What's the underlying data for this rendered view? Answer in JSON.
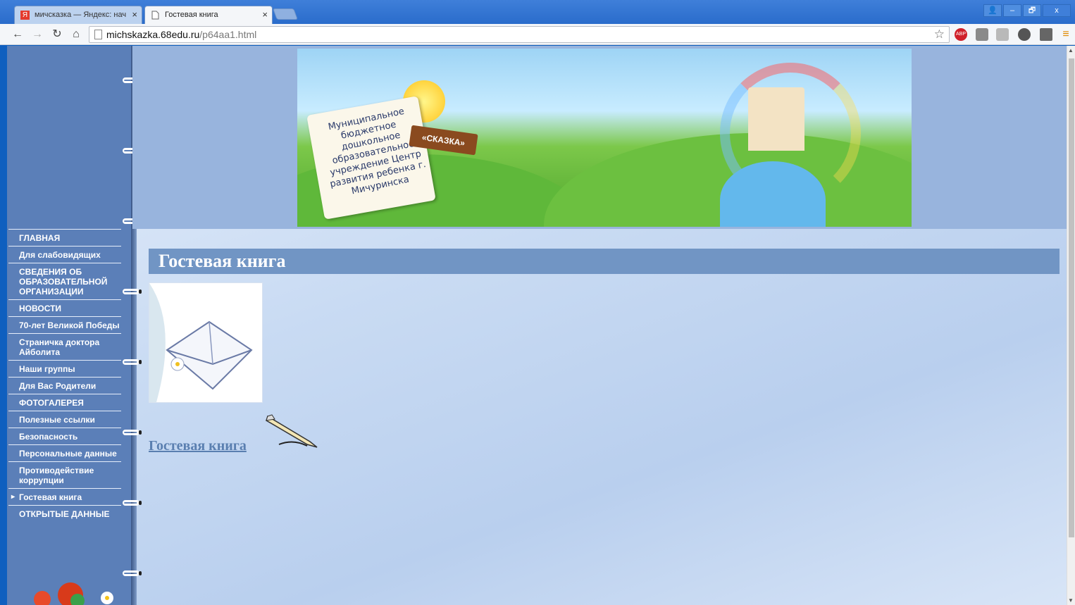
{
  "browser": {
    "tabs": [
      {
        "favicon": "Я",
        "title": "мичсказка — Яндекс: нач",
        "close": "×"
      },
      {
        "favicon": "page-icon",
        "title": "Гостевая книга",
        "close": "×"
      }
    ],
    "url_host": "michskazka.68edu.ru",
    "url_path": "/p64aa1.html",
    "abp_badge": "ABP",
    "window_controls": [
      "👤",
      "–",
      "🗗",
      "x"
    ]
  },
  "banner": {
    "sign_text": "Муниципальное бюджетное дошкольное образовательное учреждение Центр развития ребенка г. Мичуринска",
    "sign_name": "«СКАЗКА»"
  },
  "sidebar": {
    "items": [
      {
        "label": "ГЛАВНАЯ",
        "active": false
      },
      {
        "label": "Для слабовидящих",
        "active": false
      },
      {
        "label": "СВЕДЕНИЯ ОБ ОБРАЗОВАТЕЛЬНОЙ ОРГАНИЗАЦИИ",
        "active": false
      },
      {
        "label": "НОВОСТИ",
        "active": false
      },
      {
        "label": "70-лет Великой Победы",
        "active": false
      },
      {
        "label": "Страничка доктора Айболита",
        "active": false
      },
      {
        "label": "Наши группы",
        "active": false
      },
      {
        "label": "Для Вас Родители",
        "active": false
      },
      {
        "label": "ФОТОГАЛЕРЕЯ",
        "active": false
      },
      {
        "label": "Полезные ссылки",
        "active": false
      },
      {
        "label": "Безопасность",
        "active": false
      },
      {
        "label": "Персональные данные",
        "active": false
      },
      {
        "label": "Противодействие коррупции",
        "active": false
      },
      {
        "label": "Гостевая книга",
        "active": true
      },
      {
        "label": "ОТКРЫТЫЕ ДАННЫЕ",
        "active": false
      }
    ]
  },
  "main": {
    "title": "Гостевая книга",
    "link": "Гостевая книга"
  },
  "colors": {
    "sidebar": "#5b7fb8",
    "title_bar": "#7195c4",
    "link": "#5a7fb0"
  }
}
